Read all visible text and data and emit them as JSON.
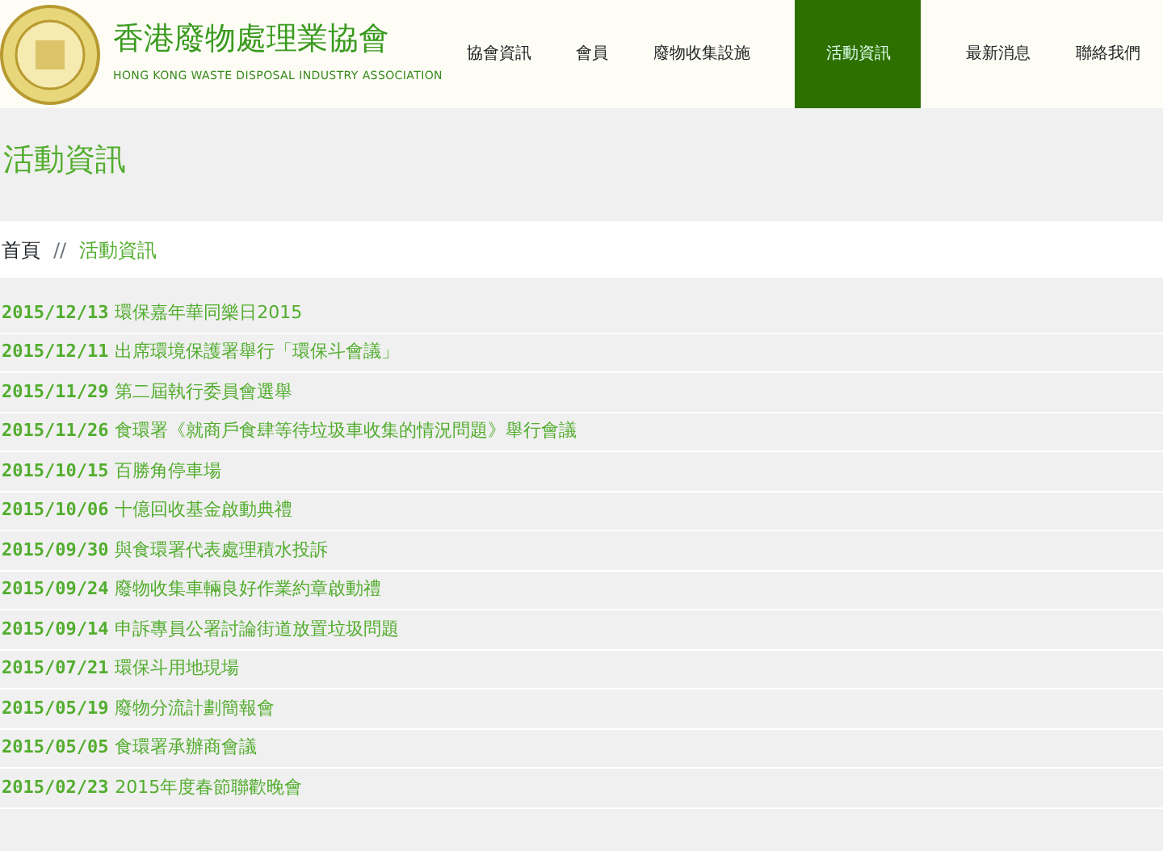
{
  "header": {
    "title": "香港廢物處理業協會",
    "subtitle": "HONG KONG WASTE DISPOSAL INDUSTRY ASSOCIATION"
  },
  "nav": [
    {
      "label": "協會資訊",
      "selected": false
    },
    {
      "label": "會員",
      "selected": false
    },
    {
      "label": "廢物收集設施",
      "selected": false
    },
    {
      "label": "活動資訊",
      "selected": true
    },
    {
      "label": "最新消息",
      "selected": false
    },
    {
      "label": "聯絡我們",
      "selected": false
    }
  ],
  "page_title": "活動資訊",
  "breadcrumb": [
    "首頁",
    "活動資訊"
  ],
  "breadcrumb_separator": "//",
  "events": [
    {
      "date": "2015/12/13",
      "title": "環保嘉年華同樂日2015"
    },
    {
      "date": "2015/12/11",
      "title": "出席環境保護署舉行「環保斗會議」"
    },
    {
      "date": "2015/11/29",
      "title": "第二屆執行委員會選舉"
    },
    {
      "date": "2015/11/26",
      "title": "食環署《就商戶食肆等待垃圾車收集的情況問題》舉行會議"
    },
    {
      "date": "2015/10/15",
      "title": "百勝角停車場"
    },
    {
      "date": "2015/10/06",
      "title": "十億回收基金啟動典禮"
    },
    {
      "date": "2015/09/30",
      "title": "與食環署代表處理積水投訴"
    },
    {
      "date": "2015/09/24",
      "title": "廢物收集車輛良好作業約章啟動禮"
    },
    {
      "date": "2015/09/14",
      "title": "申訴專員公署討論街道放置垃圾問題"
    },
    {
      "date": "2015/07/21",
      "title": "環保斗用地現場"
    },
    {
      "date": "2015/05/19",
      "title": "廢物分流計劃簡報會"
    },
    {
      "date": "2015/05/05",
      "title": "食環署承辦商會議"
    },
    {
      "date": "2015/02/23",
      "title": "2015年度春節聯歡晚會"
    }
  ]
}
